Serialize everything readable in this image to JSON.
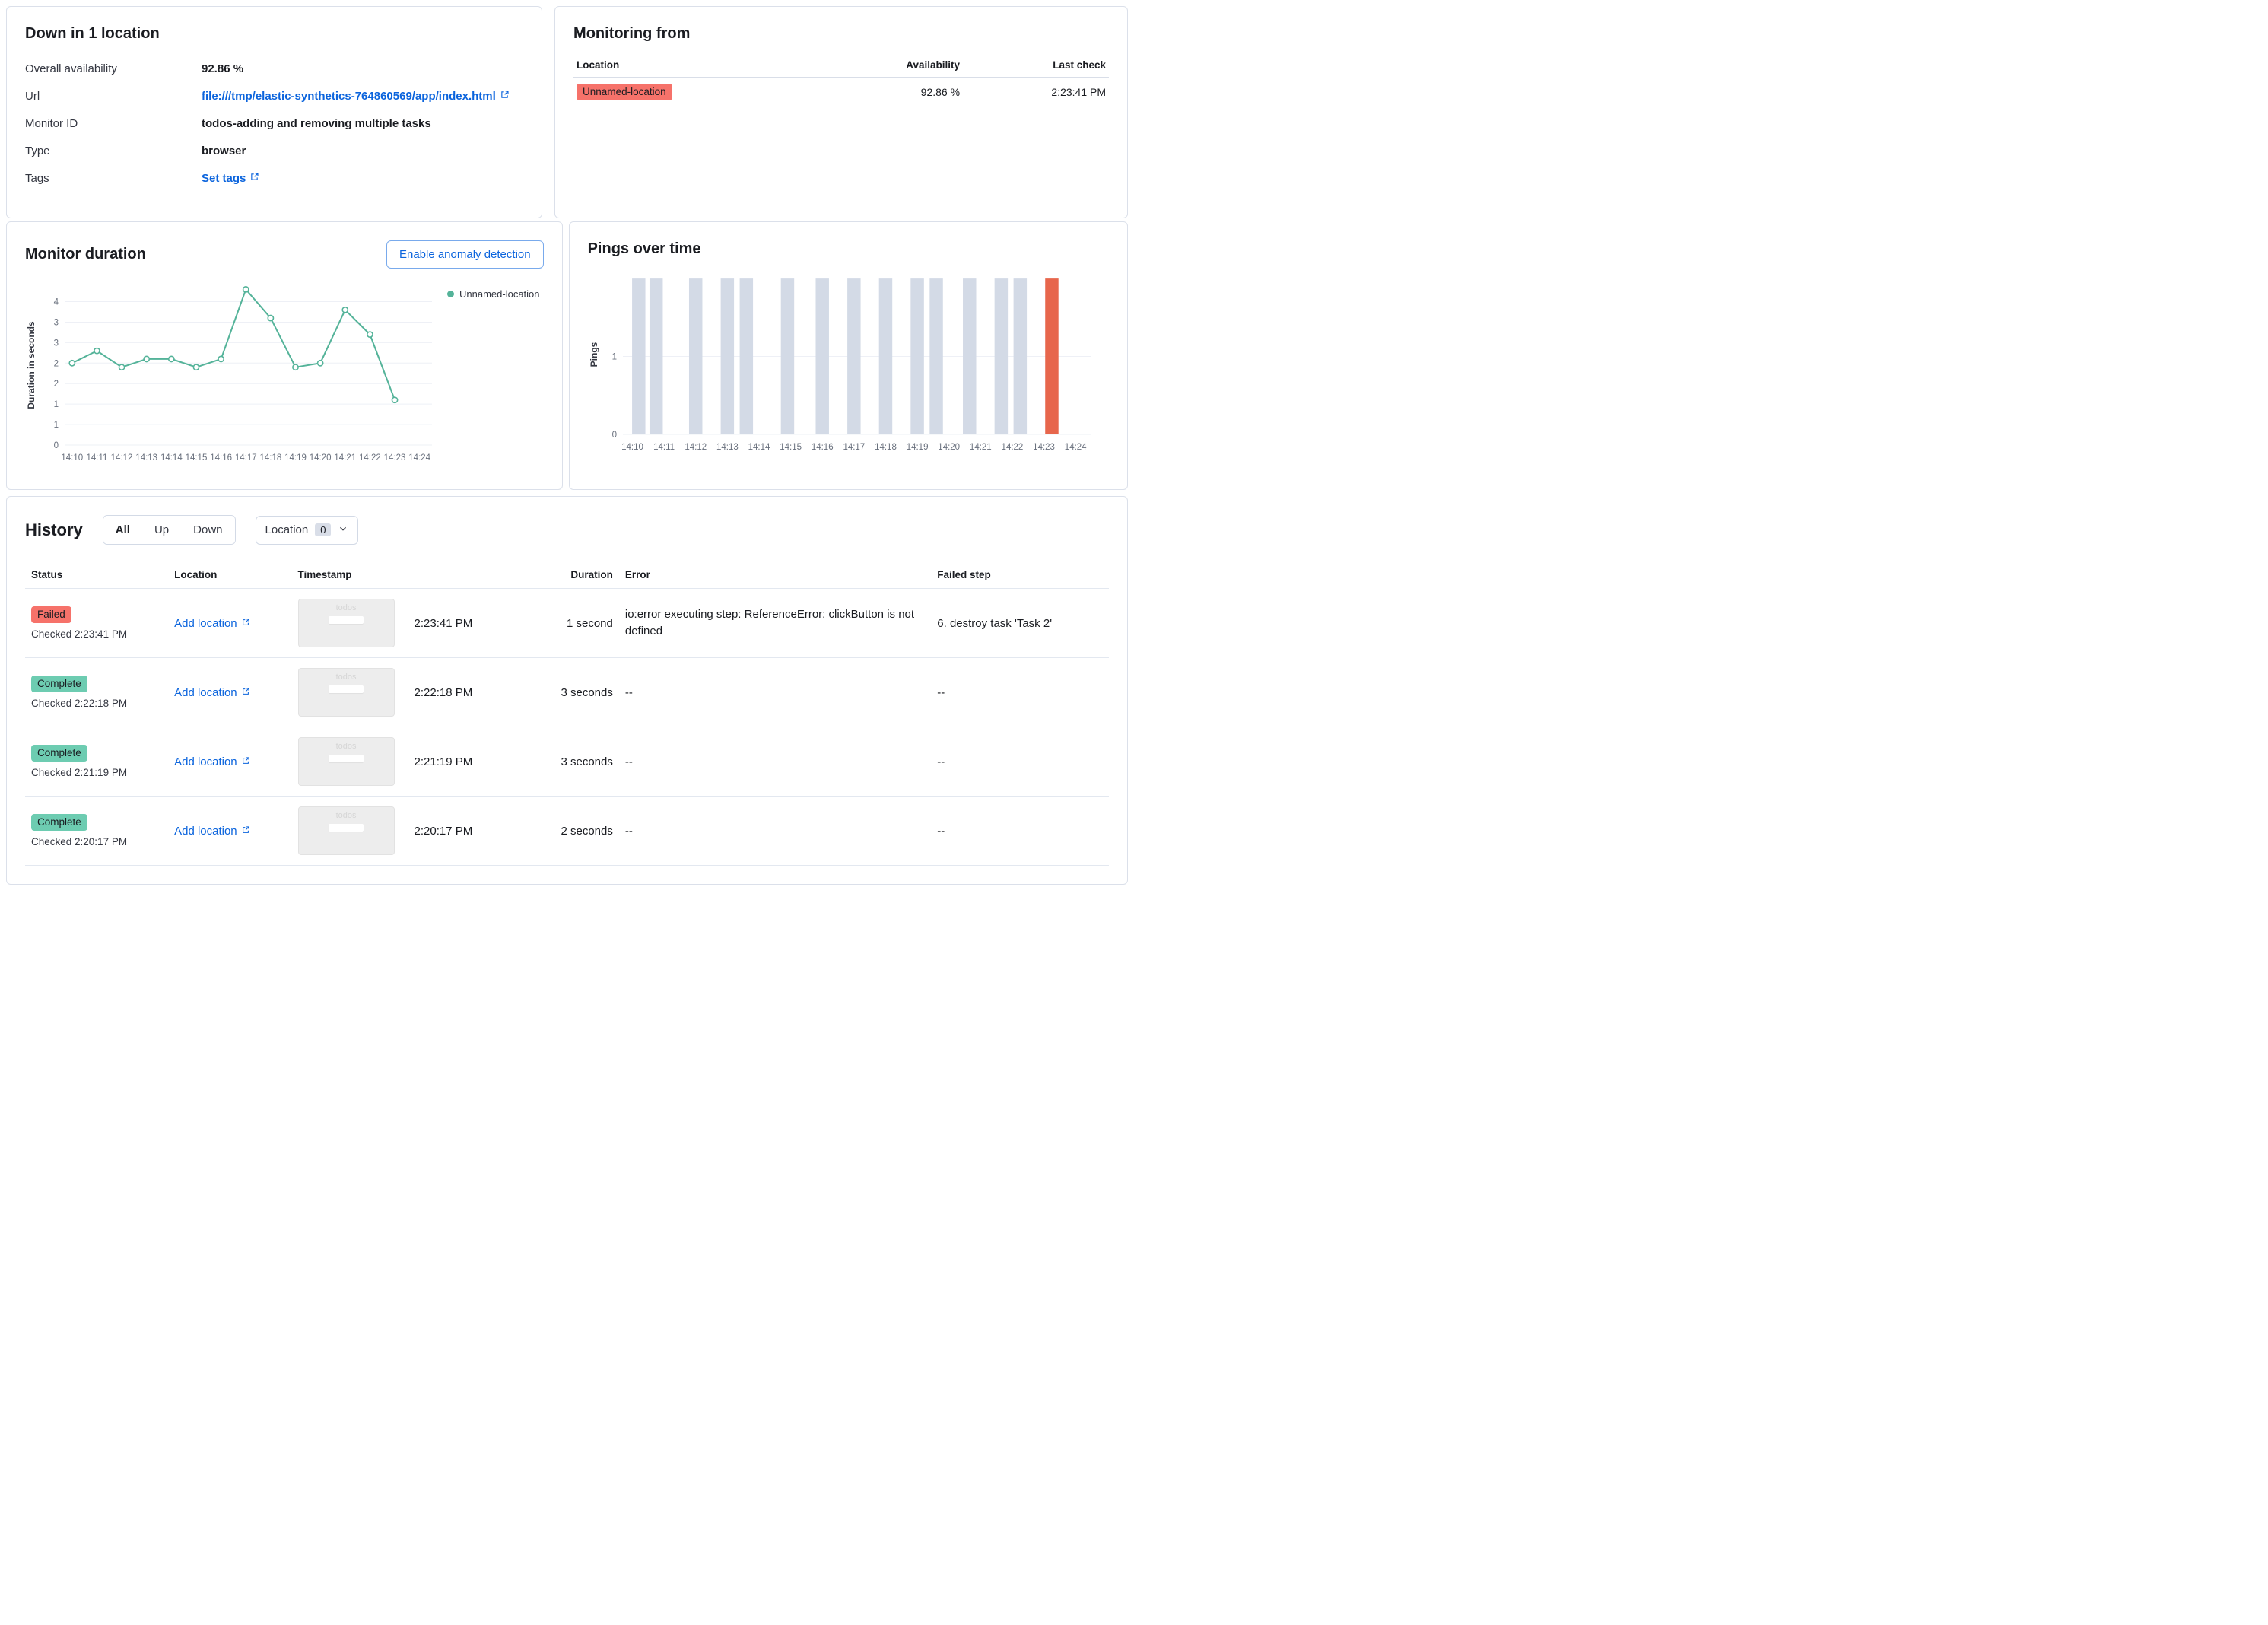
{
  "colors": {
    "danger": "#f6726a",
    "success": "#6dccb1",
    "link": "#0b64dd",
    "line": "#54b399",
    "bar_up": "#d3dae6",
    "bar_down": "#e7664c"
  },
  "status_panel": {
    "title": "Down in 1 location",
    "rows": [
      {
        "label": "Overall availability",
        "value": "92.86 %"
      },
      {
        "label": "Url",
        "value": "file:///tmp/elastic-synthetics-764860569/app/index.html"
      },
      {
        "label": "Monitor ID",
        "value": "todos-adding and removing multiple tasks"
      },
      {
        "label": "Type",
        "value": "browser"
      },
      {
        "label": "Tags",
        "value": "Set tags"
      }
    ]
  },
  "monitoring_from": {
    "title": "Monitoring from",
    "columns": [
      "Location",
      "Availability",
      "Last check"
    ],
    "row": {
      "location": "Unnamed-location",
      "availability": "92.86 %",
      "last_check": "2:23:41 PM"
    }
  },
  "duration_panel": {
    "title": "Monitor duration",
    "button": "Enable anomaly detection",
    "legend": "Unnamed-location"
  },
  "pings_panel": {
    "title": "Pings over time"
  },
  "history": {
    "title": "History",
    "filters": [
      "All",
      "Up",
      "Down"
    ],
    "selected_filter": "All",
    "location_filter": {
      "label": "Location",
      "count": "0"
    },
    "columns": [
      "Status",
      "Location",
      "Timestamp",
      "Duration",
      "Error",
      "Failed step"
    ],
    "thumbnail_label": "todos",
    "rows": [
      {
        "status": "Failed",
        "checked": "Checked 2:23:41 PM",
        "location": "Add location",
        "timestamp": "2:23:41 PM",
        "duration": "1 second",
        "error": "io:error executing step: ReferenceError: clickButton is not defined",
        "failed_step": "6. destroy task 'Task 2'"
      },
      {
        "status": "Complete",
        "checked": "Checked 2:22:18 PM",
        "location": "Add location",
        "timestamp": "2:22:18 PM",
        "duration": "3 seconds",
        "error": "--",
        "failed_step": "--"
      },
      {
        "status": "Complete",
        "checked": "Checked 2:21:19 PM",
        "location": "Add location",
        "timestamp": "2:21:19 PM",
        "duration": "3 seconds",
        "error": "--",
        "failed_step": "--"
      },
      {
        "status": "Complete",
        "checked": "Checked 2:20:17 PM",
        "location": "Add location",
        "timestamp": "2:20:17 PM",
        "duration": "2 seconds",
        "error": "--",
        "failed_step": "--"
      }
    ]
  },
  "chart_data": [
    {
      "type": "line",
      "title": "Monitor duration",
      "ylabel": "Duration in seconds",
      "x_unit": "minutes after 14:00",
      "xmin": 9.7,
      "xmax": 24.5,
      "ymin": 0,
      "ymax": 3.9,
      "grid": true,
      "legend_position": "right",
      "series": [
        {
          "name": "Unnamed-location",
          "color": "#54b399",
          "x": [
            10,
            11,
            12,
            13,
            14,
            15,
            16,
            17,
            18,
            19,
            20,
            21,
            22,
            23
          ],
          "values": [
            2.0,
            2.3,
            1.9,
            2.1,
            2.1,
            1.9,
            2.1,
            3.8,
            3.1,
            1.9,
            2.0,
            3.3,
            2.7,
            1.1
          ]
        }
      ],
      "xticks": [
        {
          "v": 10,
          "label": "14:10"
        },
        {
          "v": 11,
          "label": "14:11"
        },
        {
          "v": 12,
          "label": "14:12"
        },
        {
          "v": 13,
          "label": "14:13"
        },
        {
          "v": 14,
          "label": "14:14"
        },
        {
          "v": 15,
          "label": "14:15"
        },
        {
          "v": 16,
          "label": "14:16"
        },
        {
          "v": 17,
          "label": "14:17"
        },
        {
          "v": 18,
          "label": "14:18"
        },
        {
          "v": 19,
          "label": "14:19"
        },
        {
          "v": 20,
          "label": "14:20"
        },
        {
          "v": 21,
          "label": "14:21"
        },
        {
          "v": 22,
          "label": "14:22"
        },
        {
          "v": 23,
          "label": "14:23"
        },
        {
          "v": 24,
          "label": "14:24"
        }
      ],
      "yticks": [
        {
          "v": 0,
          "label": "0"
        },
        {
          "v": 0.5,
          "label": "1"
        },
        {
          "v": 1,
          "label": "1"
        },
        {
          "v": 1.5,
          "label": "2"
        },
        {
          "v": 2,
          "label": "2"
        },
        {
          "v": 2.5,
          "label": "3"
        },
        {
          "v": 3,
          "label": "3"
        },
        {
          "v": 3.5,
          "label": "4"
        }
      ]
    },
    {
      "type": "bar",
      "title": "Pings over time",
      "ylabel": "Pings",
      "x_unit": "minutes after 14:00",
      "xmin": 9.7,
      "xmax": 24.5,
      "ymin": 0,
      "ymax": 2.05,
      "bar_width_minutes": 0.42,
      "colors": {
        "up": "#d3dae6",
        "down": "#e7664c"
      },
      "bars": [
        {
          "x": 10.2,
          "value": 2,
          "status": "up"
        },
        {
          "x": 10.75,
          "value": 2,
          "status": "up"
        },
        {
          "x": 12.0,
          "value": 2,
          "status": "up"
        },
        {
          "x": 13.0,
          "value": 2,
          "status": "up"
        },
        {
          "x": 13.6,
          "value": 2,
          "status": "up"
        },
        {
          "x": 14.9,
          "value": 2,
          "status": "up"
        },
        {
          "x": 16.0,
          "value": 2,
          "status": "up"
        },
        {
          "x": 17.0,
          "value": 2,
          "status": "up"
        },
        {
          "x": 18.0,
          "value": 2,
          "status": "up"
        },
        {
          "x": 19.0,
          "value": 2,
          "status": "up"
        },
        {
          "x": 19.6,
          "value": 2,
          "status": "up"
        },
        {
          "x": 20.65,
          "value": 2,
          "status": "up"
        },
        {
          "x": 21.65,
          "value": 2,
          "status": "up"
        },
        {
          "x": 22.25,
          "value": 2,
          "status": "up"
        },
        {
          "x": 23.25,
          "value": 2,
          "status": "down"
        }
      ],
      "xticks": [
        {
          "v": 10,
          "label": "14:10"
        },
        {
          "v": 11,
          "label": "14:11"
        },
        {
          "v": 12,
          "label": "14:12"
        },
        {
          "v": 13,
          "label": "14:13"
        },
        {
          "v": 14,
          "label": "14:14"
        },
        {
          "v": 15,
          "label": "14:15"
        },
        {
          "v": 16,
          "label": "14:16"
        },
        {
          "v": 17,
          "label": "14:17"
        },
        {
          "v": 18,
          "label": "14:18"
        },
        {
          "v": 19,
          "label": "14:19"
        },
        {
          "v": 20,
          "label": "14:20"
        },
        {
          "v": 21,
          "label": "14:21"
        },
        {
          "v": 22,
          "label": "14:22"
        },
        {
          "v": 23,
          "label": "14:23"
        },
        {
          "v": 24,
          "label": "14:24"
        }
      ],
      "yticks": [
        {
          "v": 0,
          "label": "0"
        },
        {
          "v": 1,
          "label": "1"
        }
      ]
    }
  ]
}
